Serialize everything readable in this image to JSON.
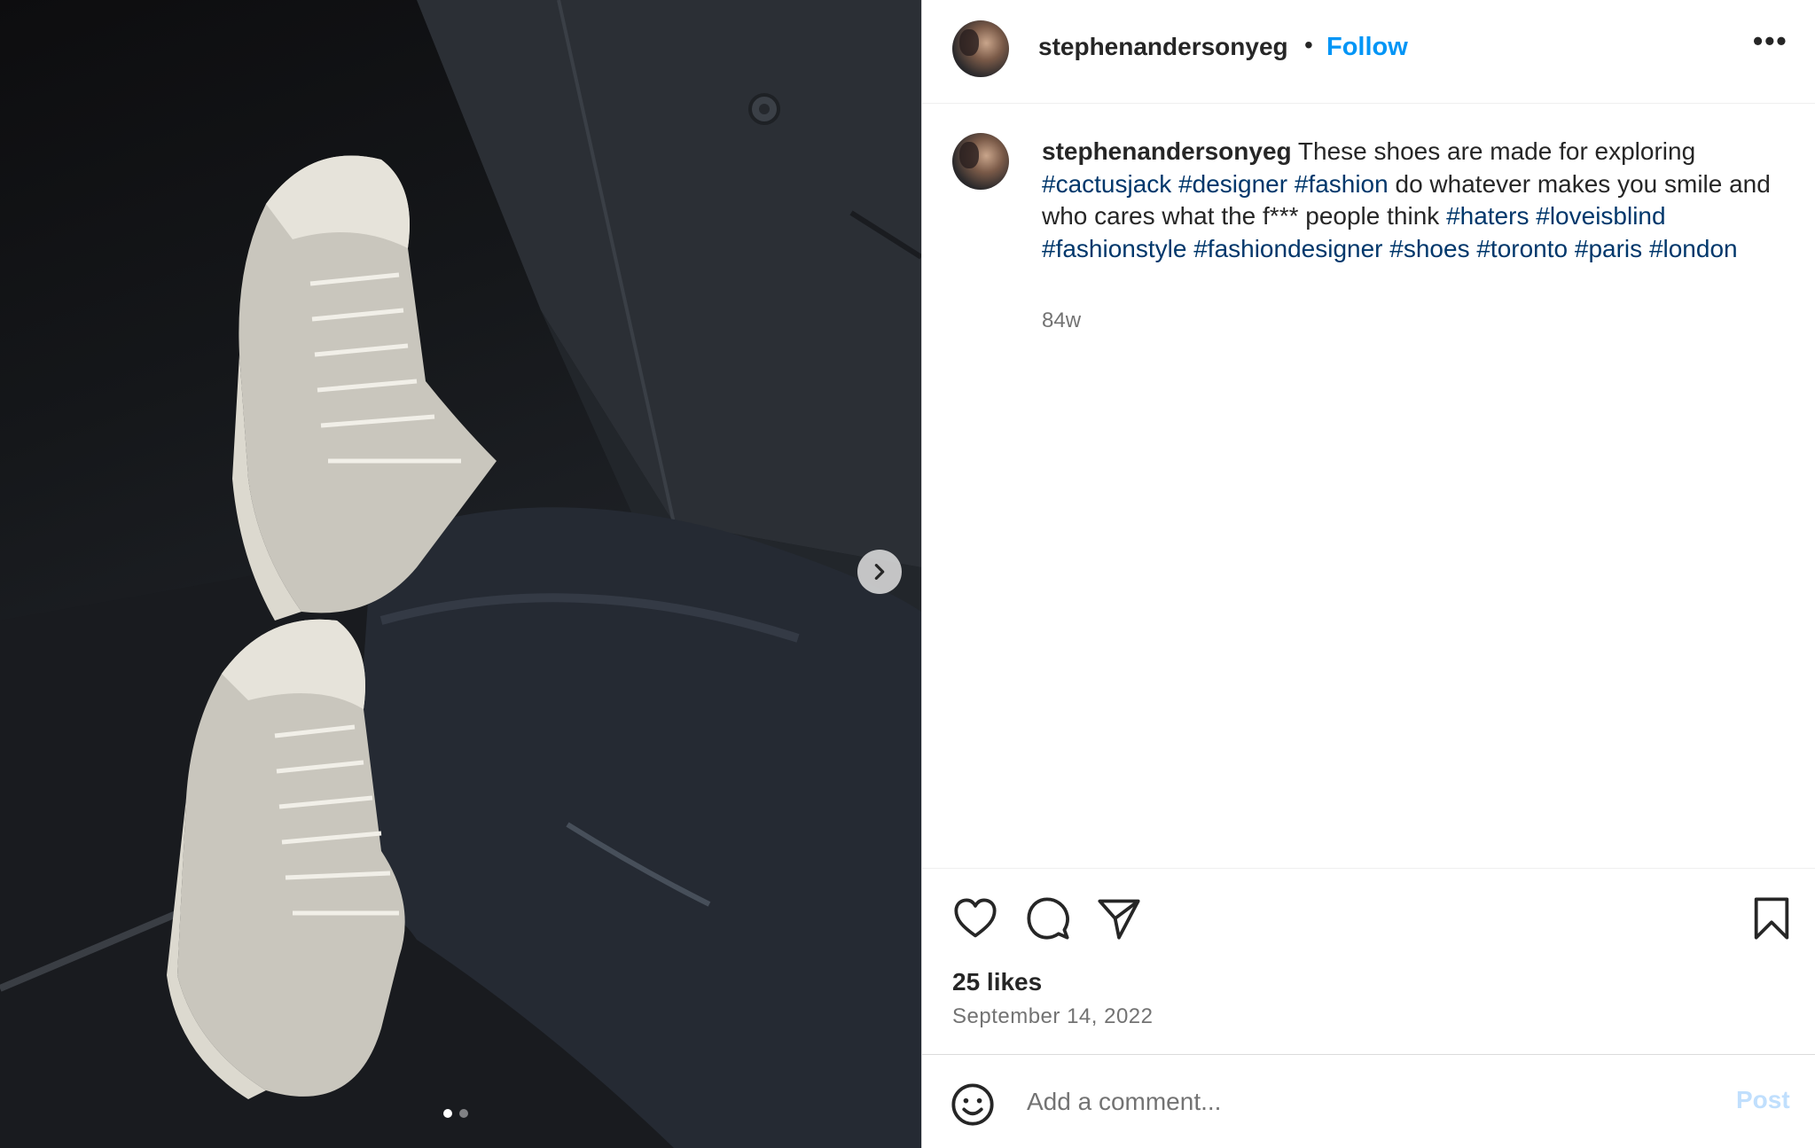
{
  "post": {
    "username": "stephenandersonyeg",
    "separator": "•",
    "follow_label": "Follow",
    "more_icon": "more-options-icon",
    "caption": {
      "username": "stephenandersonyeg",
      "text_1": "These shoes are made for exploring",
      "tags_1": [
        "#cactusjack",
        "#designer",
        "#fashion"
      ],
      "text_2": "do whatever makes you smile and who cares what the f*** people think",
      "tags_2": [
        "#haters",
        "#loveisblind",
        "#fashionstyle",
        "#fashiondesigner",
        "#shoes",
        "#toronto",
        "#paris",
        "#london"
      ]
    },
    "time_ago": "84w",
    "likes": "25 likes",
    "date": "September 14, 2022"
  },
  "actions": {
    "like_icon": "heart-icon",
    "comment_icon": "comment-icon",
    "share_icon": "share-icon",
    "save_icon": "bookmark-icon"
  },
  "comment": {
    "placeholder": "Add a comment...",
    "post_label": "Post",
    "emoji_icon": "emoji-icon"
  },
  "carousel": {
    "next_icon": "chevron-right-icon",
    "current_slide": 1,
    "total_slides": 2
  },
  "colors": {
    "link_blue": "#0095f6",
    "hashtag": "#00376b",
    "muted": "#737373",
    "post_disabled": "#c0dffd"
  }
}
